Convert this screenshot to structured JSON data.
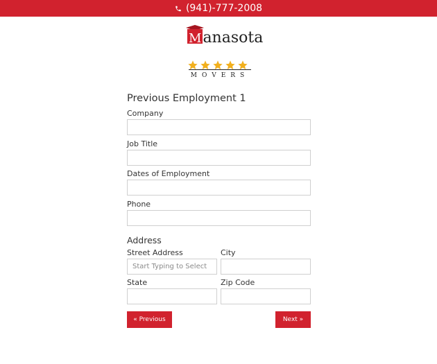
{
  "topbar": {
    "phone": "(941)-777-2008",
    "icon": "phone-icon",
    "bg_color": "#d1222e"
  },
  "logo": {
    "initial": "M",
    "brand_rest": "anasota",
    "subtitle": "MOVERS",
    "rating_stars": 5,
    "star_color": "#f2b01e"
  },
  "employment": {
    "title": "Previous Employment 1",
    "company_label": "Company",
    "company_value": "",
    "job_title_label": "Job Title",
    "job_title_value": "",
    "dates_label": "Dates of Employment",
    "dates_value": "",
    "phone_label": "Phone",
    "phone_value": ""
  },
  "address": {
    "title": "Address",
    "street_label": "Street Address",
    "street_placeholder": "Start Typing to Select",
    "street_value": "",
    "city_label": "City",
    "city_value": "",
    "state_label": "State",
    "state_value": "",
    "zip_label": "Zip Code",
    "zip_value": ""
  },
  "nav": {
    "previous_label": "« Previous",
    "next_label": "Next »"
  }
}
